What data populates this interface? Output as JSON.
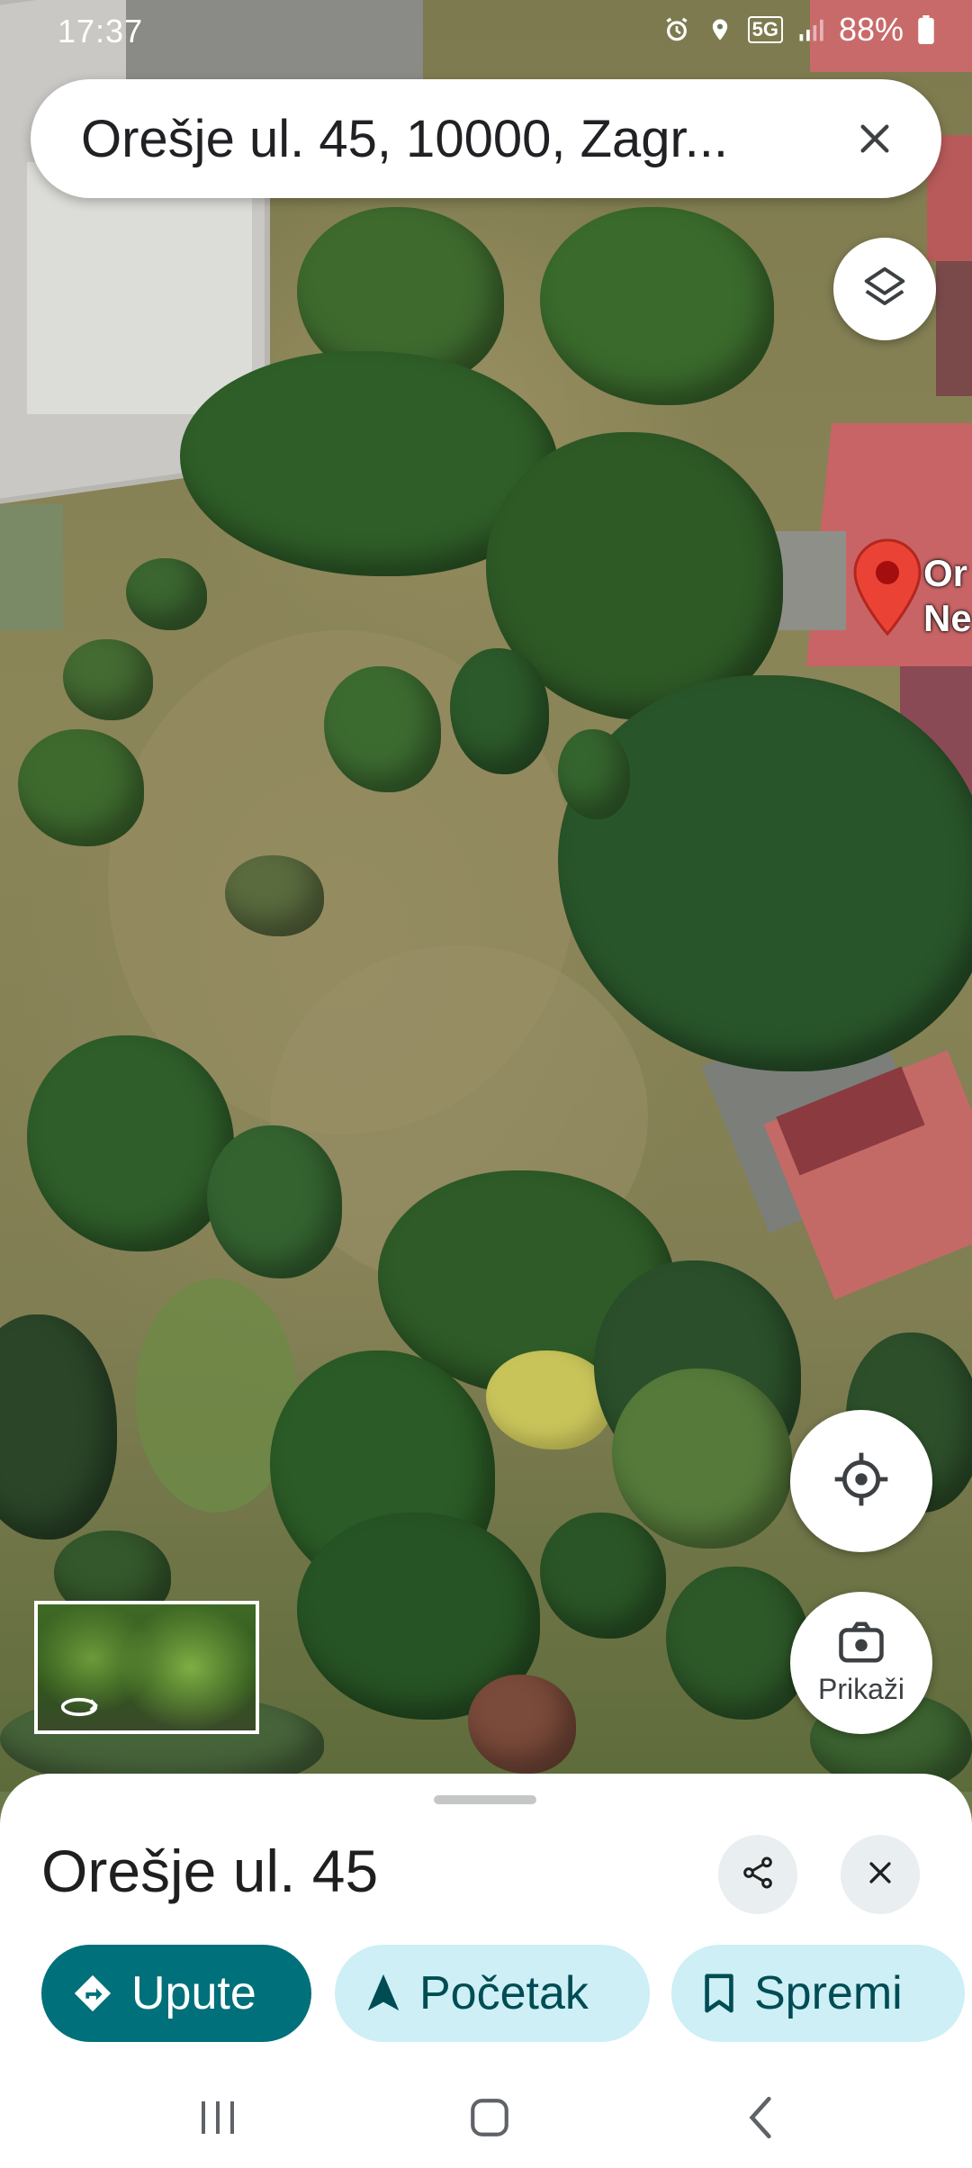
{
  "status_bar": {
    "time": "17:37",
    "network": "5G",
    "battery": "88%",
    "icons": [
      "alarm-icon",
      "location-icon",
      "5g-icon",
      "signal-icon",
      "battery-icon"
    ]
  },
  "search": {
    "query": "Orešje ul. 45, 10000, Zagr...",
    "close_icon": "close-icon"
  },
  "map": {
    "type": "satellite",
    "marker": {
      "label_line1": "Or",
      "label_line2": "Ne",
      "color": "#ea4335"
    },
    "layers_icon": "layers-icon",
    "locate_icon": "my-location-icon",
    "street_view_button_label": "Prikaži"
  },
  "place_sheet": {
    "title": "Orešje ul. 45",
    "actions": {
      "directions": "Upute",
      "start": "Početak",
      "save": "Spremi"
    },
    "accent": "#00707a",
    "chip_tint": "#cdeff5"
  },
  "nav_bar": {
    "icons": [
      "recents-icon",
      "home-icon",
      "back-icon"
    ]
  }
}
